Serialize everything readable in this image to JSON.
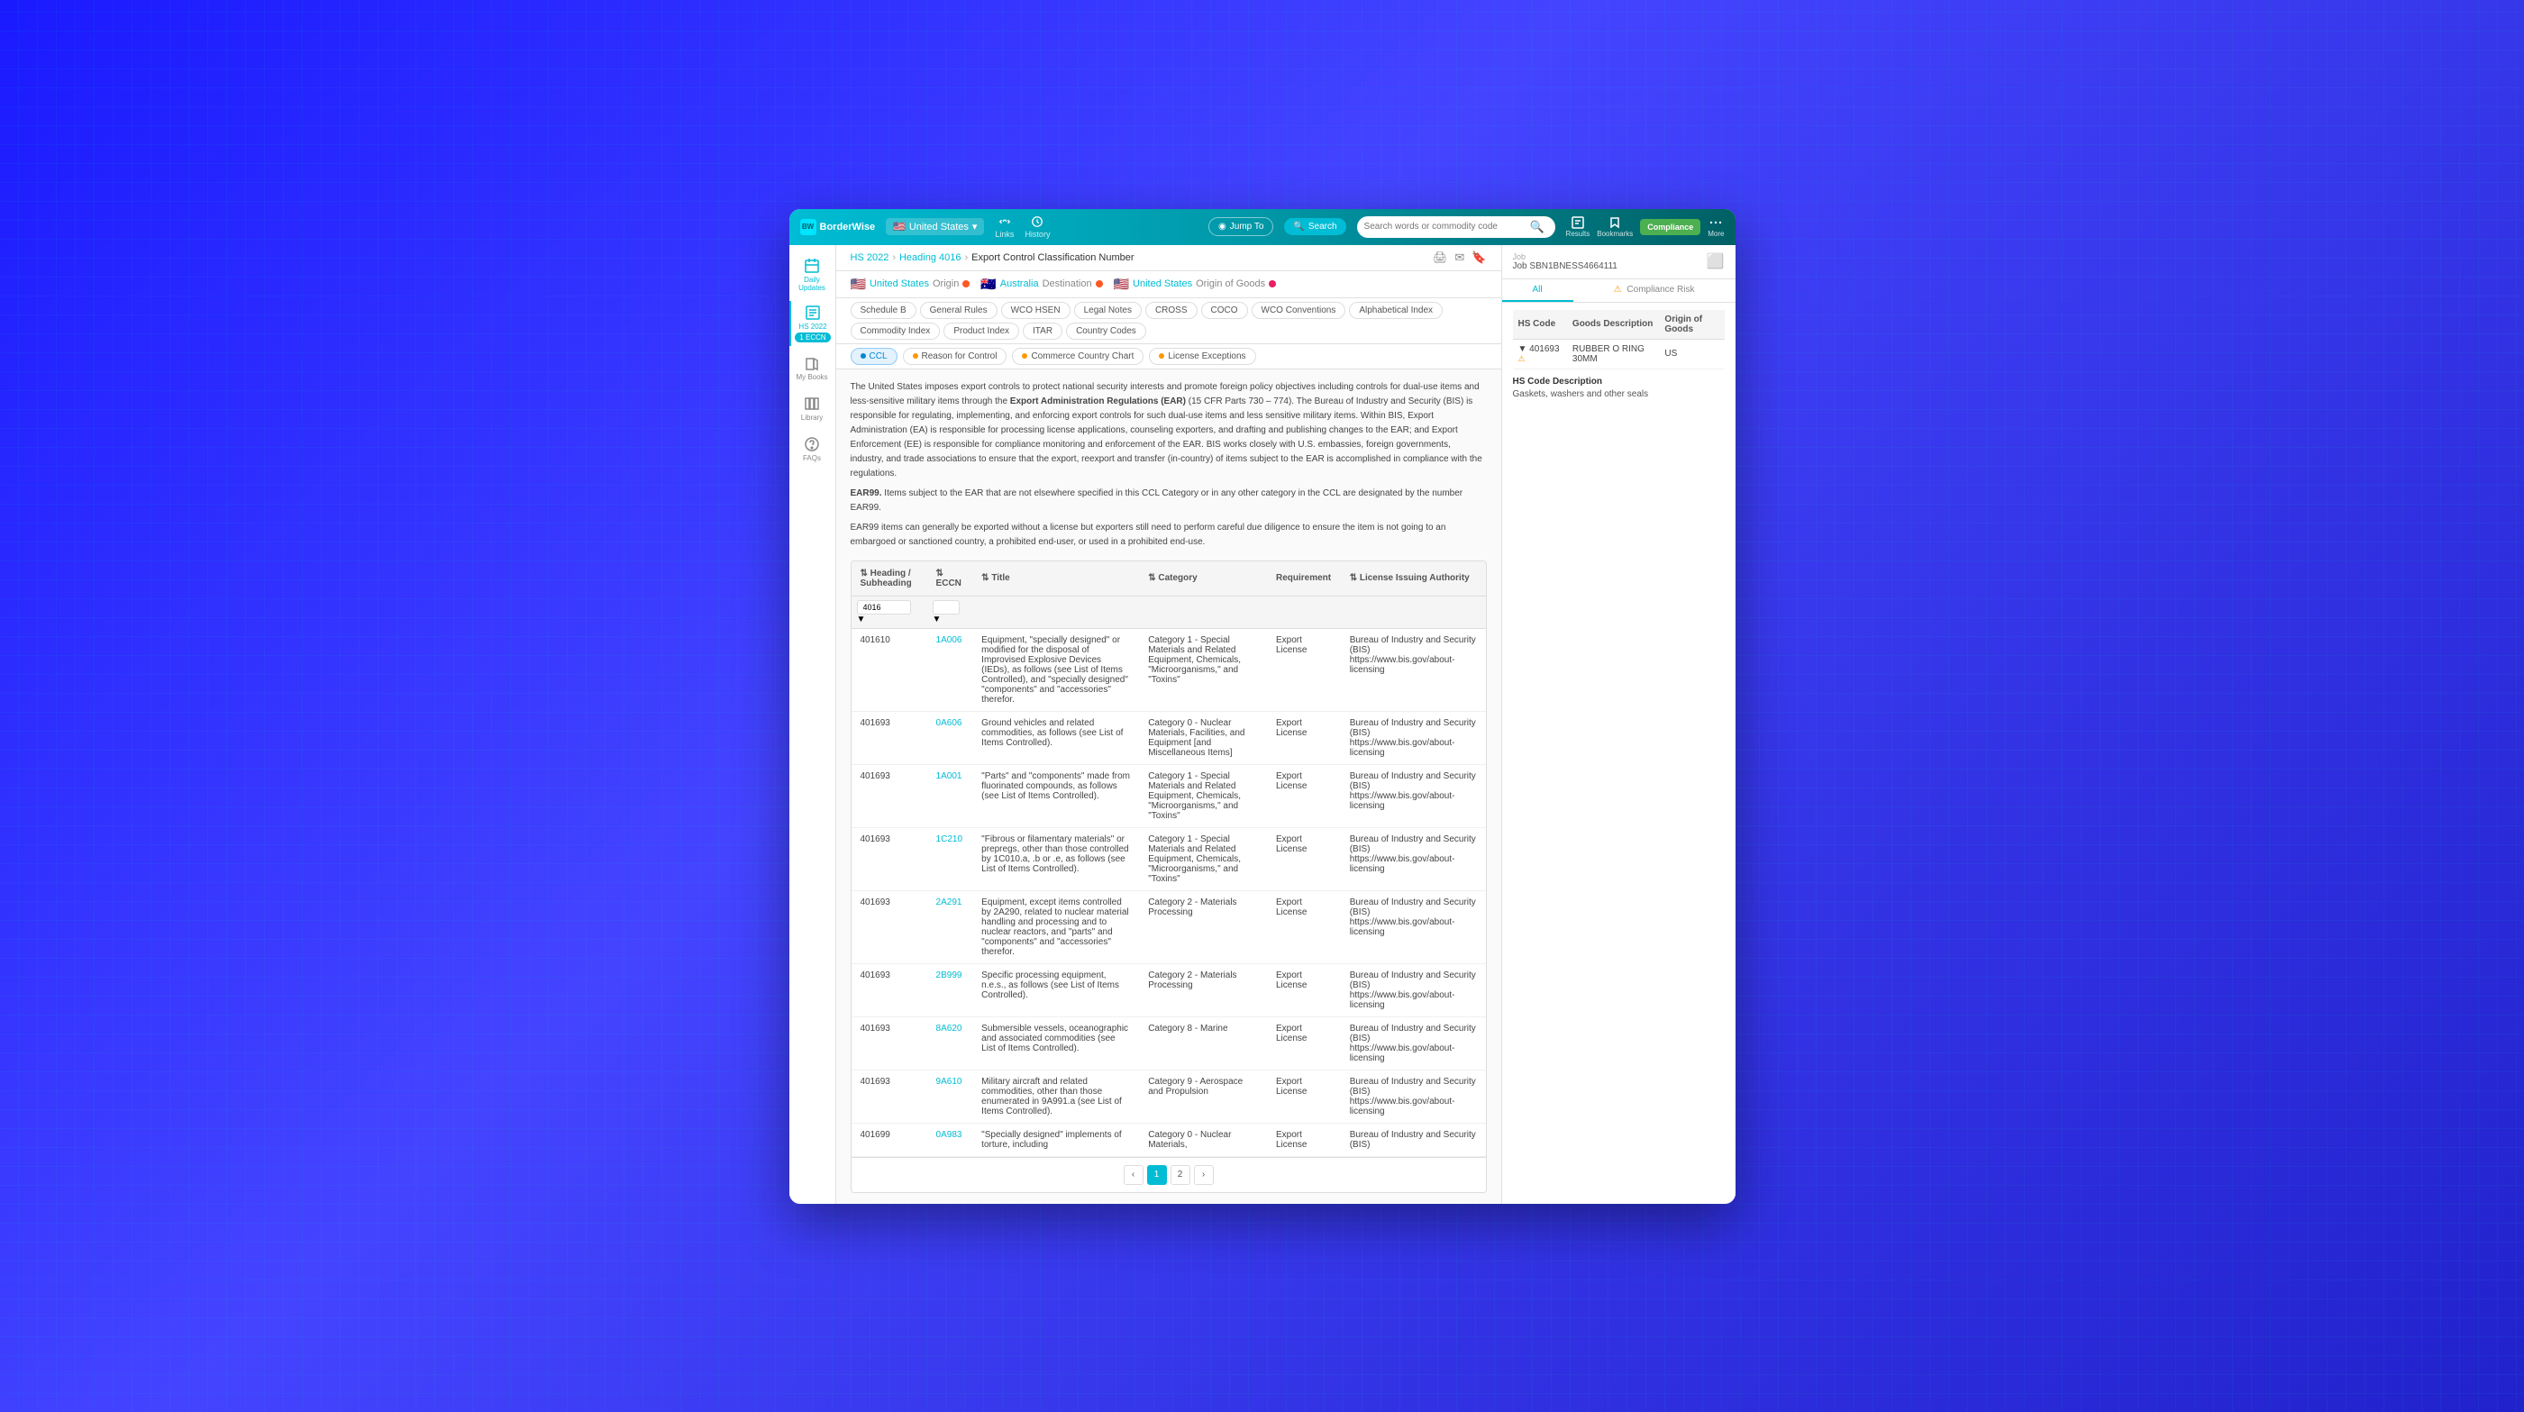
{
  "app": {
    "name": "BorderWise",
    "country": "United States"
  },
  "topnav": {
    "search_placeholder": "Search words or commodity code",
    "search_label": "Search",
    "jump_label": "Jump To",
    "links_label": "Links",
    "history_label": "History",
    "results_label": "Results",
    "bookmarks_label": "Bookmarks",
    "compliance_label": "Compliance",
    "more_label": "More"
  },
  "breadcrumb": {
    "hs_year": "HS 2022",
    "heading": "Heading 4016",
    "page": "Export Control Classification Number"
  },
  "origins": [
    {
      "flag": "🇺🇸",
      "label": "United States",
      "sublabel": "Origin",
      "warning": true
    },
    {
      "flag": "🇦🇺",
      "label": "Australia",
      "sublabel": "Destination",
      "warning": true
    },
    {
      "flag": "🇺🇸",
      "label": "United States",
      "sublabel": "Origin of Goods",
      "warning": false
    }
  ],
  "tabs": [
    {
      "label": "Schedule B",
      "active": false
    },
    {
      "label": "General Rules",
      "active": false
    },
    {
      "label": "WCO HSEN",
      "active": false
    },
    {
      "label": "Legal Notes",
      "active": false
    },
    {
      "label": "CROSS",
      "active": false
    },
    {
      "label": "COCO",
      "active": false
    },
    {
      "label": "WCO Conventions",
      "active": false
    },
    {
      "label": "Alphabetical Index",
      "active": false
    },
    {
      "label": "Commodity Index",
      "active": false
    },
    {
      "label": "Product Index",
      "active": false
    },
    {
      "label": "ITAR",
      "active": false
    },
    {
      "label": "Country Codes",
      "active": false
    }
  ],
  "subtabs": [
    {
      "label": "CCL",
      "active": true,
      "type": "active"
    },
    {
      "label": "Reason for Control",
      "active": false
    },
    {
      "label": "Commerce Country Chart",
      "active": false
    },
    {
      "label": "License Exceptions",
      "active": false
    }
  ],
  "hs_sidebar": {
    "label": "HS 2022",
    "badge": "1 ECCN"
  },
  "content_text": [
    "The United States imposes export controls to protect national security interests and promote foreign policy objectives including controls for dual-use items and less-sensitive military items through the Export Administration Regulations (EAR) (15 CFR Parts 730 – 774). The Bureau of Industry and Security (BIS) is responsible for regulating, implementing, and enforcing export controls for such dual-use items and less sensitive military items. Within BIS, Export Administration (EA) is responsible for processing license applications, counseling exporters, and drafting and publishing changes to the EAR; and Export Enforcement (EE) is responsible for compliance monitoring and enforcement of the EAR. BIS works closely with U.S. embassies, foreign governments, industry, and trade associations to ensure that the export, reexport and transfer (in-country) of items subject to the EAR is accomplished in compliance with the regulations.",
    "EAR99. Items subject to the EAR that are not elsewhere specified in this CCL Category or in any other category in the CCL are designated by the number EAR99.",
    "EAR99 items can generally be exported without a license but exporters still need to perform careful due diligence to ensure the item is not going to an embargoed or sanctioned country, a prohibited end-user, or used in a prohibited end-use."
  ],
  "table": {
    "columns": [
      {
        "label": "Heading / Subheading",
        "sortable": true
      },
      {
        "label": "ECCN",
        "sortable": true
      },
      {
        "label": "Title",
        "sortable": true
      },
      {
        "label": "Category",
        "sortable": true
      },
      {
        "label": "Requirement",
        "sortable": false
      },
      {
        "label": "License Issuing Authority",
        "sortable": false
      }
    ],
    "filter_heading": "4016",
    "rows": [
      {
        "heading": "401610",
        "eccn": "1A006",
        "title": "Equipment, \"specially designed\" or modified for the disposal of Improvised Explosive Devices (IEDs), as follows (see List of Items Controlled), and \"specially designed\" \"components\" and \"accessories\" therefor.",
        "category": "Category 1 - Special Materials and Related Equipment, Chemicals, \"Microorganisms,\" and \"Toxins\"",
        "requirement": "Export License",
        "authority": "Bureau of Industry and Security (BIS) https://www.bis.gov/about-licensing"
      },
      {
        "heading": "401693",
        "eccn": "0A606",
        "title": "Ground vehicles and related commodities, as follows (see List of Items Controlled).",
        "category": "Category 0 - Nuclear Materials, Facilities, and Equipment [and Miscellaneous Items]",
        "requirement": "Export License",
        "authority": "Bureau of Industry and Security (BIS) https://www.bis.gov/about-licensing"
      },
      {
        "heading": "401693",
        "eccn": "1A001",
        "title": "\"Parts\" and \"components\" made from fluorinated compounds, as follows (see List of Items Controlled).",
        "category": "Category 1 - Special Materials and Related Equipment, Chemicals, \"Microorganisms,\" and \"Toxins\"",
        "requirement": "Export License",
        "authority": "Bureau of Industry and Security (BIS) https://www.bis.gov/about-licensing"
      },
      {
        "heading": "401693",
        "eccn": "1C210",
        "title": "\"Fibrous or filamentary materials\" or prepregs, other than those controlled by 1C010.a, .b or .e, as follows (see List of Items Controlled).",
        "category": "Category 1 - Special Materials and Related Equipment, Chemicals, \"Microorganisms,\" and \"Toxins\"",
        "requirement": "Export License",
        "authority": "Bureau of Industry and Security (BIS) https://www.bis.gov/about-licensing"
      },
      {
        "heading": "401693",
        "eccn": "2A291",
        "title": "Equipment, except items controlled by 2A290, related to nuclear material handling and processing and to nuclear reactors, and \"parts\" and \"components\" and \"accessories\" therefor.",
        "category": "Category 2 - Materials Processing",
        "requirement": "Export License",
        "authority": "Bureau of Industry and Security (BIS) https://www.bis.gov/about-licensing"
      },
      {
        "heading": "401693",
        "eccn": "2B999",
        "title": "Specific processing equipment, n.e.s., as follows (see List of Items Controlled).",
        "category": "Category 2 - Materials Processing",
        "requirement": "Export License",
        "authority": "Bureau of Industry and Security (BIS) https://www.bis.gov/about-licensing"
      },
      {
        "heading": "401693",
        "eccn": "8A620",
        "title": "Submersible vessels, oceanographic and associated commodities (see List of Items Controlled).",
        "category": "Category 8 - Marine",
        "requirement": "Export License",
        "authority": "Bureau of Industry and Security (BIS) https://www.bis.gov/about-licensing"
      },
      {
        "heading": "401693",
        "eccn": "9A610",
        "title": "Military aircraft and related commodities, other than those enumerated in 9A991.a (see List of Items Controlled).",
        "category": "Category 9 - Aerospace and Propulsion",
        "requirement": "Export License",
        "authority": "Bureau of Industry and Security (BIS) https://www.bis.gov/about-licensing"
      },
      {
        "heading": "401699",
        "eccn": "0A983",
        "title": "\"Specially designed\" implements of torture, including",
        "category": "Category 0 - Nuclear Materials,",
        "requirement": "Export License",
        "authority": "Bureau of Industry and Security (BIS)"
      }
    ]
  },
  "pagination": {
    "current": 1,
    "pages": [
      "1",
      "2"
    ],
    "prev": "‹",
    "next": "›"
  },
  "right_panel": {
    "job_id": "Job SBN1BNESS4664111",
    "tabs": [
      "All",
      "Compliance Risk"
    ],
    "hs_table": {
      "columns": [
        "HS Code",
        "Goods Description",
        "Origin of Goods"
      ],
      "rows": [
        {
          "code": "401693",
          "description": "RUBBER O RING 30MM",
          "origin": "US",
          "warning": true
        }
      ]
    },
    "hs_desc_label": "HS Code Description",
    "hs_desc_text": "Gaskets, washers and other seals"
  },
  "sidebar_nav": [
    {
      "label": "Daily Updates",
      "icon": "home"
    },
    {
      "label": "HS 2022",
      "icon": "list"
    },
    {
      "label": "My Books",
      "icon": "book"
    },
    {
      "label": "Library",
      "icon": "library"
    },
    {
      "label": "FAQs",
      "icon": "faq"
    }
  ]
}
